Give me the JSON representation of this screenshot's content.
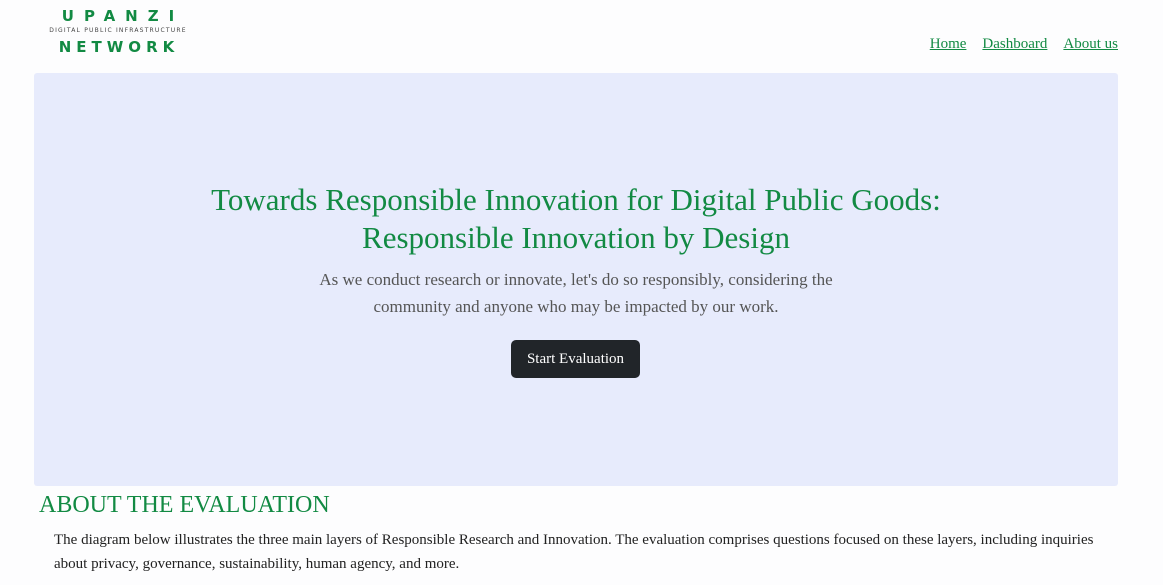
{
  "logo": {
    "line1": "UPANZI",
    "line2": "DIGITAL PUBLIC INFRASTRUCTURE",
    "line3": "NETWORK"
  },
  "nav": {
    "items": [
      {
        "label": "Home"
      },
      {
        "label": "Dashboard"
      },
      {
        "label": "About us"
      }
    ]
  },
  "hero": {
    "title_line1": "Towards Responsible Innovation for Digital Public Goods:",
    "title_line2": "Responsible Innovation by Design",
    "subtitle": "As we conduct research or innovate, let's do so responsibly, considering the community and anyone who may be impacted by our work.",
    "button_label": "Start Evaluation"
  },
  "about": {
    "heading": "ABOUT THE EVALUATION",
    "text": "The diagram below illustrates the three main layers of Responsible Research and Innovation. The evaluation comprises questions focused on these layers, including inquiries about privacy, governance, sustainability, human agency, and more."
  },
  "colors": {
    "brand_green": "#128a43",
    "hero_background": "#e7ebfc",
    "button_background": "#212529"
  }
}
